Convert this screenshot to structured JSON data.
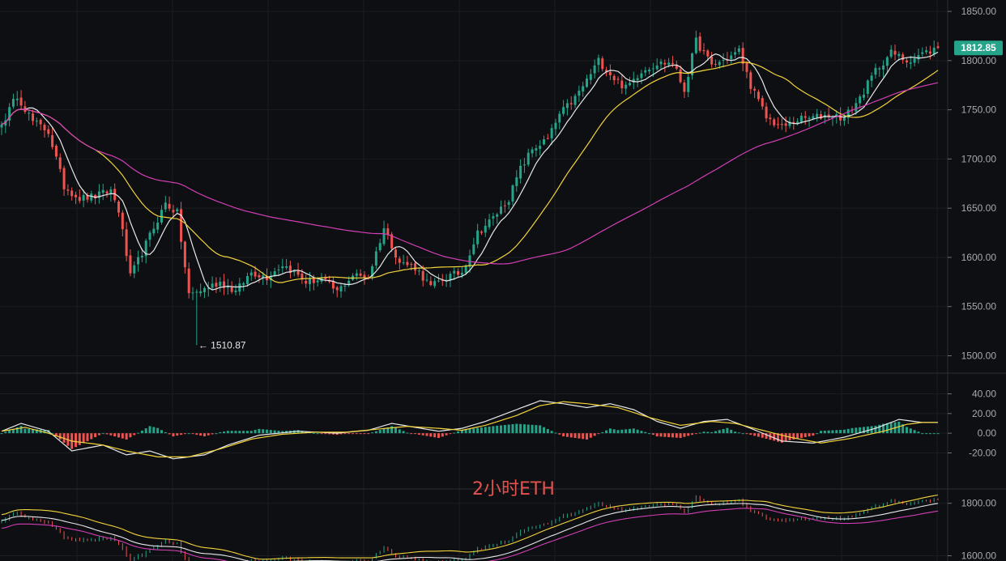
{
  "chart_data": [
    {
      "type": "candlestick",
      "panel": "price",
      "y_ticks": [
        1850,
        1800,
        1750,
        1700,
        1650,
        1600,
        1550,
        1500
      ],
      "y_tick_labels": [
        "1850.00",
        "1800.00",
        "1750.00",
        "1700.00",
        "1650.00",
        "1600.00",
        "1550.00",
        "1500.00"
      ],
      "ylim": [
        1493,
        1855
      ],
      "last_price": "1812.85",
      "low_label": "← 1510.87",
      "low_value": 1510.87,
      "grid": true,
      "close_keypoints": [
        [
          0,
          1735
        ],
        [
          4,
          1765
        ],
        [
          8,
          1738
        ],
        [
          12,
          1728
        ],
        [
          16,
          1672
        ],
        [
          20,
          1660
        ],
        [
          24,
          1662
        ],
        [
          28,
          1668
        ],
        [
          30,
          1648
        ],
        [
          33,
          1580
        ],
        [
          38,
          1622
        ],
        [
          42,
          1655
        ],
        [
          45,
          1645
        ],
        [
          48,
          1562
        ],
        [
          52,
          1568
        ],
        [
          56,
          1575
        ],
        [
          60,
          1565
        ],
        [
          64,
          1585
        ],
        [
          68,
          1580
        ],
        [
          72,
          1593
        ],
        [
          75,
          1585
        ],
        [
          78,
          1575
        ],
        [
          82,
          1578
        ],
        [
          86,
          1565
        ],
        [
          90,
          1582
        ],
        [
          94,
          1580
        ],
        [
          98,
          1630
        ],
        [
          102,
          1595
        ],
        [
          106,
          1590
        ],
        [
          110,
          1570
        ],
        [
          114,
          1580
        ],
        [
          118,
          1585
        ],
        [
          122,
          1625
        ],
        [
          126,
          1640
        ],
        [
          130,
          1660
        ],
        [
          133,
          1690
        ],
        [
          136,
          1710
        ],
        [
          140,
          1720
        ],
        [
          143,
          1745
        ],
        [
          147,
          1762
        ],
        [
          150,
          1780
        ],
        [
          153,
          1800
        ],
        [
          157,
          1782
        ],
        [
          160,
          1772
        ],
        [
          164,
          1790
        ],
        [
          168,
          1797
        ],
        [
          172,
          1798
        ],
        [
          175,
          1770
        ],
        [
          178,
          1820
        ],
        [
          182,
          1795
        ],
        [
          186,
          1802
        ],
        [
          189,
          1810
        ],
        [
          192,
          1775
        ],
        [
          196,
          1742
        ],
        [
          200,
          1732
        ],
        [
          204,
          1740
        ],
        [
          208,
          1742
        ],
        [
          212,
          1745
        ],
        [
          216,
          1742
        ],
        [
          220,
          1762
        ],
        [
          224,
          1790
        ],
        [
          228,
          1808
        ],
        [
          232,
          1800
        ],
        [
          236,
          1807
        ],
        [
          240,
          1812.85
        ]
      ],
      "series": [
        {
          "name": "",
          "color": "#e7e8ea",
          "type": "moving-average",
          "period": 7
        },
        {
          "name": "",
          "color": "#f2d33b",
          "type": "moving-average",
          "period": 25
        },
        {
          "name": "",
          "color": "#d23fb5",
          "type": "moving-average",
          "period": 99
        }
      ],
      "colors": {
        "up": "#26a48a",
        "down": "#ef5350"
      }
    },
    {
      "type": "bar",
      "panel": "macd",
      "y_ticks": [
        40,
        20,
        0,
        -20
      ],
      "y_tick_labels": [
        "40.00",
        "20.00",
        "0.00",
        "-20.00"
      ],
      "ylim": [
        -27,
        47
      ],
      "dif_keypoints": [
        [
          0,
          2
        ],
        [
          5,
          10
        ],
        [
          12,
          2
        ],
        [
          18,
          -18
        ],
        [
          26,
          -12
        ],
        [
          32,
          -22
        ],
        [
          38,
          -18
        ],
        [
          44,
          -26
        ],
        [
          52,
          -22
        ],
        [
          58,
          -12
        ],
        [
          66,
          -2
        ],
        [
          76,
          2
        ],
        [
          86,
          0
        ],
        [
          94,
          3
        ],
        [
          100,
          10
        ],
        [
          106,
          6
        ],
        [
          112,
          2
        ],
        [
          118,
          5
        ],
        [
          124,
          12
        ],
        [
          132,
          24
        ],
        [
          138,
          33
        ],
        [
          144,
          30
        ],
        [
          150,
          26
        ],
        [
          156,
          30
        ],
        [
          162,
          24
        ],
        [
          168,
          12
        ],
        [
          174,
          5
        ],
        [
          180,
          12
        ],
        [
          186,
          14
        ],
        [
          192,
          5
        ],
        [
          200,
          -8
        ],
        [
          208,
          -10
        ],
        [
          216,
          -4
        ],
        [
          224,
          5
        ],
        [
          230,
          14
        ],
        [
          236,
          11
        ],
        [
          240,
          11
        ]
      ],
      "dea_keypoints": [
        [
          0,
          2
        ],
        [
          6,
          6
        ],
        [
          12,
          0
        ],
        [
          18,
          -8
        ],
        [
          26,
          -12
        ],
        [
          32,
          -18
        ],
        [
          40,
          -24
        ],
        [
          48,
          -24
        ],
        [
          56,
          -16
        ],
        [
          64,
          -6
        ],
        [
          72,
          -1
        ],
        [
          80,
          1
        ],
        [
          88,
          1
        ],
        [
          96,
          4
        ],
        [
          104,
          7
        ],
        [
          112,
          5
        ],
        [
          118,
          3
        ],
        [
          124,
          8
        ],
        [
          132,
          18
        ],
        [
          138,
          28
        ],
        [
          144,
          32
        ],
        [
          150,
          30
        ],
        [
          158,
          26
        ],
        [
          166,
          16
        ],
        [
          174,
          8
        ],
        [
          182,
          12
        ],
        [
          188,
          10
        ],
        [
          194,
          4
        ],
        [
          202,
          -4
        ],
        [
          210,
          -10
        ],
        [
          218,
          -5
        ],
        [
          226,
          2
        ],
        [
          232,
          9
        ],
        [
          236,
          11
        ],
        [
          240,
          11
        ]
      ],
      "colors": {
        "up": "#26a48a",
        "down": "#ef5350",
        "dif": "#e7e8ea",
        "dea": "#f2d33b"
      }
    },
    {
      "type": "line",
      "panel": "mini",
      "y_ticks": [
        1800,
        1600
      ],
      "y_tick_labels": [
        "1800.00",
        "1600.00"
      ],
      "ylim": [
        1580,
        1830
      ],
      "upper_band_color": "#f2d33b",
      "lower_band_color": "#d23fb5",
      "middle_color": "#e7e8ea"
    }
  ],
  "title_overlay": "2小时ETH"
}
